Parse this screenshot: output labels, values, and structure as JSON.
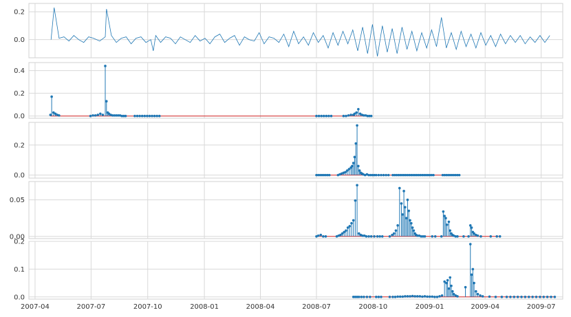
{
  "chart_data": [
    {
      "type": "line",
      "panel": 1,
      "x_axis": "date",
      "xlim": [
        "2007-03-22",
        "2009-08-05"
      ],
      "ylim": [
        -0.13,
        0.26
      ],
      "yticks": [
        0.0,
        0.2
      ],
      "ytick_labels": [
        "0.0",
        "0.2"
      ],
      "grid": true,
      "color": "#1f77b4",
      "series": [
        {
          "x": [
            "2007-04-27",
            "2007-05-02",
            "2007-05-10",
            "2007-05-18",
            "2007-05-26",
            "2007-06-03",
            "2007-06-11",
            "2007-06-19",
            "2007-06-27",
            "2007-07-05",
            "2007-07-15",
            "2007-07-24",
            "2007-07-26",
            "2007-08-03",
            "2007-08-11",
            "2007-08-19",
            "2007-08-27",
            "2007-09-04",
            "2007-09-12",
            "2007-09-20",
            "2007-09-28",
            "2007-10-06",
            "2007-10-10",
            "2007-10-14",
            "2007-10-22",
            "2007-10-30",
            "2007-11-07",
            "2007-11-15",
            "2007-11-23",
            "2007-12-01",
            "2007-12-09",
            "2007-12-17",
            "2007-12-25",
            "2008-01-02",
            "2008-01-10",
            "2008-01-18",
            "2008-01-26",
            "2008-02-03",
            "2008-02-11",
            "2008-02-19",
            "2008-02-27",
            "2008-03-06",
            "2008-03-14",
            "2008-03-22",
            "2008-03-30",
            "2008-04-07",
            "2008-04-15",
            "2008-04-23",
            "2008-05-01",
            "2008-05-09",
            "2008-05-17",
            "2008-05-25",
            "2008-06-02",
            "2008-06-10",
            "2008-06-18",
            "2008-06-26",
            "2008-07-04",
            "2008-07-12",
            "2008-07-20",
            "2008-07-28",
            "2008-08-05",
            "2008-08-13",
            "2008-08-21",
            "2008-08-29",
            "2008-09-06",
            "2008-09-14",
            "2008-09-22",
            "2008-09-30",
            "2008-10-08",
            "2008-10-16",
            "2008-10-24",
            "2008-11-01",
            "2008-11-09",
            "2008-11-17",
            "2008-11-25",
            "2008-12-03",
            "2008-12-11",
            "2008-12-19",
            "2008-12-27",
            "2009-01-04",
            "2009-01-12",
            "2009-01-20",
            "2009-01-28",
            "2009-02-05",
            "2009-02-13",
            "2009-02-21",
            "2009-03-01",
            "2009-03-09",
            "2009-03-17",
            "2009-03-25",
            "2009-04-02",
            "2009-04-10",
            "2009-04-18",
            "2009-04-26",
            "2009-05-04",
            "2009-05-12",
            "2009-05-20",
            "2009-05-28",
            "2009-06-05",
            "2009-06-13",
            "2009-06-21",
            "2009-06-29",
            "2009-07-07",
            "2009-07-15"
          ],
          "y": [
            0.0,
            0.23,
            0.01,
            0.02,
            -0.01,
            0.03,
            0.0,
            -0.02,
            0.02,
            0.01,
            -0.01,
            0.02,
            0.22,
            0.03,
            -0.02,
            0.01,
            0.02,
            -0.03,
            0.01,
            0.02,
            -0.02,
            0.0,
            -0.08,
            0.03,
            -0.02,
            0.02,
            0.01,
            -0.03,
            0.02,
            0.0,
            -0.02,
            0.03,
            -0.01,
            0.01,
            -0.03,
            0.02,
            0.04,
            -0.02,
            0.01,
            0.03,
            -0.04,
            0.02,
            0.0,
            -0.01,
            0.05,
            -0.03,
            0.02,
            0.01,
            -0.02,
            0.04,
            -0.05,
            0.06,
            -0.03,
            0.02,
            -0.04,
            0.05,
            -0.02,
            0.03,
            -0.06,
            0.05,
            -0.04,
            0.06,
            -0.03,
            0.07,
            -0.08,
            0.09,
            -0.1,
            0.11,
            -0.12,
            0.1,
            -0.09,
            0.08,
            -0.1,
            0.09,
            -0.07,
            0.06,
            -0.08,
            0.05,
            -0.06,
            0.07,
            -0.05,
            0.16,
            -0.06,
            0.05,
            -0.07,
            0.06,
            -0.05,
            0.04,
            -0.06,
            0.05,
            -0.04,
            0.03,
            -0.05,
            0.04,
            -0.03,
            0.03,
            -0.02,
            0.03,
            -0.03,
            0.02,
            -0.02,
            0.03,
            -0.02,
            0.03
          ]
        }
      ]
    },
    {
      "type": "stem",
      "panel": 2,
      "x_axis": "date",
      "xlim": [
        "2007-03-22",
        "2009-08-05"
      ],
      "ylim": [
        -0.02,
        0.47
      ],
      "yticks": [
        0.0,
        0.2,
        0.4
      ],
      "ytick_labels": [
        "0.0",
        "0.2",
        "0.4"
      ],
      "grid": true,
      "baseline_color": "#d62728",
      "color": "#1f77b4",
      "series": [
        {
          "x": [
            "2007-04-26",
            "2007-04-28",
            "2007-05-01",
            "2007-05-04",
            "2007-05-07",
            "2007-05-10",
            "2007-06-30",
            "2007-07-04",
            "2007-07-08",
            "2007-07-12",
            "2007-07-16",
            "2007-07-20",
            "2007-07-24",
            "2007-07-26",
            "2007-07-28",
            "2007-07-30",
            "2007-08-02",
            "2007-08-05",
            "2007-08-08",
            "2007-08-11",
            "2007-08-14",
            "2007-08-17",
            "2007-08-20",
            "2007-08-23",
            "2007-08-26",
            "2007-09-10",
            "2007-09-14",
            "2007-09-18",
            "2007-09-22",
            "2007-09-26",
            "2007-09-30",
            "2007-10-04",
            "2007-10-08",
            "2007-10-12",
            "2007-10-16",
            "2007-10-20",
            "2008-07-01",
            "2008-07-05",
            "2008-07-09",
            "2008-07-13",
            "2008-07-17",
            "2008-07-21",
            "2008-07-25",
            "2008-08-14",
            "2008-08-18",
            "2008-08-22",
            "2008-08-26",
            "2008-08-30",
            "2008-09-01",
            "2008-09-04",
            "2008-09-07",
            "2008-09-10",
            "2008-09-13",
            "2008-09-16",
            "2008-09-19",
            "2008-09-22",
            "2008-09-25",
            "2008-09-28"
          ],
          "y": [
            0.01,
            0.17,
            0.03,
            0.02,
            0.01,
            0.005,
            0.0,
            0.005,
            0.005,
            0.01,
            0.02,
            0.01,
            0.44,
            0.13,
            0.03,
            0.02,
            0.01,
            0.005,
            0.005,
            0.005,
            0.005,
            0.005,
            0.0,
            0.0,
            0.0,
            0.0,
            0.0,
            0.0,
            0.0,
            0.0,
            0.0,
            0.0,
            0.0,
            0.0,
            0.0,
            0.0,
            0.0,
            0.0,
            0.0,
            0.0,
            0.0,
            0.0,
            0.0,
            0.0,
            0.0,
            0.005,
            0.01,
            0.01,
            0.02,
            0.03,
            0.06,
            0.02,
            0.01,
            0.005,
            0.005,
            0.0,
            0.0,
            0.0
          ]
        }
      ]
    },
    {
      "type": "stem",
      "panel": 3,
      "x_axis": "date",
      "xlim": [
        "2007-03-22",
        "2009-08-05"
      ],
      "ylim": [
        -0.02,
        0.35
      ],
      "yticks": [
        0.0,
        0.2
      ],
      "ytick_labels": [
        "0.0",
        "0.2"
      ],
      "grid": true,
      "baseline_color": "#d62728",
      "color": "#1f77b4",
      "series": [
        {
          "x": [
            "2008-07-01",
            "2008-07-04",
            "2008-07-07",
            "2008-07-10",
            "2008-07-13",
            "2008-07-16",
            "2008-07-19",
            "2008-07-22",
            "2008-08-05",
            "2008-08-08",
            "2008-08-11",
            "2008-08-14",
            "2008-08-17",
            "2008-08-20",
            "2008-08-23",
            "2008-08-26",
            "2008-08-28",
            "2008-08-30",
            "2008-09-01",
            "2008-09-03",
            "2008-09-05",
            "2008-09-07",
            "2008-09-09",
            "2008-09-11",
            "2008-09-13",
            "2008-09-15",
            "2008-09-18",
            "2008-09-21",
            "2008-09-24",
            "2008-09-27",
            "2008-09-30",
            "2008-10-03",
            "2008-10-06",
            "2008-10-10",
            "2008-10-14",
            "2008-10-18",
            "2008-10-22",
            "2008-10-26",
            "2008-11-02",
            "2008-11-05",
            "2008-11-08",
            "2008-11-11",
            "2008-11-14",
            "2008-11-17",
            "2008-11-20",
            "2008-11-23",
            "2008-11-26",
            "2008-11-29",
            "2008-12-02",
            "2008-12-05",
            "2008-12-08",
            "2008-12-11",
            "2008-12-14",
            "2008-12-17",
            "2008-12-20",
            "2008-12-23",
            "2008-12-26",
            "2008-12-29",
            "2009-01-01",
            "2009-01-04",
            "2009-01-07",
            "2009-01-22",
            "2009-01-25",
            "2009-01-28",
            "2009-01-31",
            "2009-02-03",
            "2009-02-06",
            "2009-02-09",
            "2009-02-12",
            "2009-02-15",
            "2009-02-18"
          ],
          "y": [
            0.0,
            0.0,
            0.0,
            0.0,
            0.0,
            0.0,
            0.0,
            0.0,
            0.0,
            0.005,
            0.01,
            0.015,
            0.02,
            0.03,
            0.04,
            0.05,
            0.06,
            0.08,
            0.12,
            0.21,
            0.33,
            0.06,
            0.03,
            0.015,
            0.01,
            0.005,
            0.0,
            0.005,
            0.0,
            0.0,
            0.0,
            0.0,
            0.0,
            0.0,
            0.0,
            0.0,
            0.0,
            0.0,
            0.0,
            0.0,
            0.0,
            0.0,
            0.0,
            0.0,
            0.0,
            0.0,
            0.0,
            0.0,
            0.0,
            0.0,
            0.0,
            0.0,
            0.0,
            0.0,
            0.0,
            0.0,
            0.0,
            0.0,
            0.0,
            0.0,
            0.0,
            0.0,
            0.0,
            0.0,
            0.0,
            0.0,
            0.0,
            0.0,
            0.0,
            0.0,
            0.0
          ]
        }
      ]
    },
    {
      "type": "stem",
      "panel": 4,
      "x_axis": "date",
      "xlim": [
        "2007-03-22",
        "2009-08-05"
      ],
      "ylim": [
        -0.003,
        0.075
      ],
      "yticks": [
        0.0,
        0.05
      ],
      "ytick_labels": [
        "0.00",
        "0.05"
      ],
      "grid": true,
      "baseline_color": "#d62728",
      "color": "#1f77b4",
      "series": [
        {
          "x": [
            "2008-07-01",
            "2008-07-04",
            "2008-07-08",
            "2008-07-12",
            "2008-07-16",
            "2008-08-03",
            "2008-08-06",
            "2008-08-09",
            "2008-08-12",
            "2008-08-15",
            "2008-08-18",
            "2008-08-21",
            "2008-08-24",
            "2008-08-27",
            "2008-08-30",
            "2008-09-02",
            "2008-09-05",
            "2008-09-08",
            "2008-09-11",
            "2008-09-14",
            "2008-09-17",
            "2008-09-20",
            "2008-09-24",
            "2008-09-28",
            "2008-10-03",
            "2008-10-08",
            "2008-10-12",
            "2008-10-16",
            "2008-10-28",
            "2008-11-01",
            "2008-11-04",
            "2008-11-07",
            "2008-11-10",
            "2008-11-13",
            "2008-11-16",
            "2008-11-18",
            "2008-11-20",
            "2008-11-22",
            "2008-11-24",
            "2008-11-26",
            "2008-11-28",
            "2008-11-30",
            "2008-12-02",
            "2008-12-04",
            "2008-12-06",
            "2008-12-08",
            "2008-12-10",
            "2008-12-12",
            "2008-12-15",
            "2008-12-18",
            "2008-12-21",
            "2008-12-24",
            "2009-01-05",
            "2009-01-10",
            "2009-01-20",
            "2009-01-23",
            "2009-01-25",
            "2009-01-27",
            "2009-01-29",
            "2009-02-01",
            "2009-02-03",
            "2009-02-05",
            "2009-02-07",
            "2009-02-09",
            "2009-02-12",
            "2009-02-15",
            "2009-02-25",
            "2009-03-05",
            "2009-03-08",
            "2009-03-10",
            "2009-03-12",
            "2009-03-14",
            "2009-03-17",
            "2009-03-20",
            "2009-03-25",
            "2009-04-10",
            "2009-04-20",
            "2009-04-25"
          ],
          "y": [
            0.0,
            0.001,
            0.002,
            0.0,
            0.0,
            0.0,
            0.001,
            0.002,
            0.004,
            0.006,
            0.008,
            0.012,
            0.014,
            0.018,
            0.022,
            0.049,
            0.07,
            0.004,
            0.002,
            0.001,
            0.001,
            0.0,
            0.0,
            0.0,
            0.0,
            0.0,
            0.0,
            0.0,
            0.0,
            0.002,
            0.004,
            0.008,
            0.015,
            0.066,
            0.045,
            0.03,
            0.062,
            0.04,
            0.025,
            0.05,
            0.035,
            0.022,
            0.018,
            0.012,
            0.008,
            0.004,
            0.002,
            0.001,
            0.001,
            0.0,
            0.0,
            0.0,
            0.0,
            0.0,
            0.0,
            0.034,
            0.028,
            0.025,
            0.016,
            0.02,
            0.008,
            0.004,
            0.002,
            0.001,
            0.0,
            0.0,
            0.0,
            0.0,
            0.015,
            0.012,
            0.006,
            0.004,
            0.002,
            0.001,
            0.0,
            0.0,
            0.0,
            0.0
          ]
        }
      ]
    },
    {
      "type": "stem",
      "panel": 5,
      "x_axis": "date",
      "xlim": [
        "2007-03-22",
        "2009-08-05"
      ],
      "ylim": [
        -0.008,
        0.2
      ],
      "yticks": [
        0.0,
        0.1,
        0.2
      ],
      "ytick_labels": [
        "0.0",
        "0.1",
        "0.2"
      ],
      "grid": true,
      "baseline_color": "#d62728",
      "color": "#1f77b4",
      "xticks": [
        "2007-04-01",
        "2007-07-01",
        "2007-10-01",
        "2008-01-01",
        "2008-04-01",
        "2008-07-01",
        "2008-10-01",
        "2009-01-01",
        "2009-04-01",
        "2009-07-01"
      ],
      "xtick_labels": [
        "2007-04",
        "2007-07",
        "2007-10",
        "2008-01",
        "2008-04",
        "2008-07",
        "2008-10",
        "2009-01",
        "2009-04",
        "2009-07"
      ],
      "series": [
        {
          "x": [
            "2008-08-30",
            "2008-09-02",
            "2008-09-05",
            "2008-09-08",
            "2008-09-12",
            "2008-09-16",
            "2008-09-21",
            "2008-09-26",
            "2008-10-06",
            "2008-10-10",
            "2008-10-14",
            "2008-10-28",
            "2008-11-02",
            "2008-11-06",
            "2008-11-10",
            "2008-11-14",
            "2008-11-18",
            "2008-11-22",
            "2008-11-26",
            "2008-11-30",
            "2008-12-04",
            "2008-12-08",
            "2008-12-12",
            "2008-12-16",
            "2008-12-20",
            "2008-12-24",
            "2008-12-28",
            "2009-01-01",
            "2009-01-05",
            "2009-01-09",
            "2009-01-13",
            "2009-01-17",
            "2009-01-21",
            "2009-01-25",
            "2009-01-28",
            "2009-01-30",
            "2009-02-01",
            "2009-02-03",
            "2009-02-05",
            "2009-02-07",
            "2009-02-09",
            "2009-02-12",
            "2009-02-15",
            "2009-02-28",
            "2009-03-08",
            "2009-03-10",
            "2009-03-12",
            "2009-03-14",
            "2009-03-17",
            "2009-03-20",
            "2009-03-24",
            "2009-03-28",
            "2009-04-08",
            "2009-04-18",
            "2009-04-28",
            "2009-05-06",
            "2009-05-12",
            "2009-05-18",
            "2009-05-24",
            "2009-05-30",
            "2009-06-05",
            "2009-06-11",
            "2009-06-17",
            "2009-06-23",
            "2009-06-29",
            "2009-07-05",
            "2009-07-11",
            "2009-07-17",
            "2009-07-23"
          ],
          "y": [
            0.0,
            0.0,
            0.0,
            0.0,
            0.0,
            0.0,
            0.0,
            0.0,
            0.0,
            0.0,
            0.0,
            0.0,
            0.0,
            0.0,
            0.001,
            0.001,
            0.001,
            0.002,
            0.002,
            0.002,
            0.003,
            0.002,
            0.002,
            0.002,
            0.001,
            0.002,
            0.001,
            0.001,
            0.001,
            0.0,
            0.0,
            0.002,
            0.005,
            0.055,
            0.05,
            0.06,
            0.03,
            0.07,
            0.04,
            0.02,
            0.01,
            0.005,
            0.002,
            0.035,
            0.19,
            0.08,
            0.1,
            0.05,
            0.02,
            0.01,
            0.005,
            0.002,
            0.001,
            0.0,
            0.0,
            0.0,
            0.0,
            0.0,
            0.0,
            0.0,
            0.0,
            0.0,
            0.0,
            0.0,
            0.0,
            0.0,
            0.0,
            0.0,
            0.0
          ]
        }
      ]
    }
  ]
}
